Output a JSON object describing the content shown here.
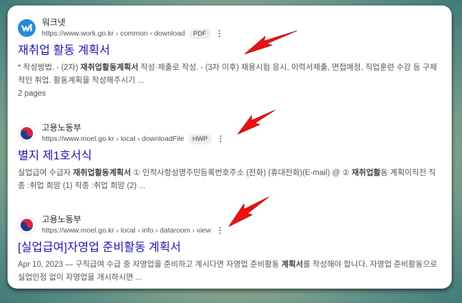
{
  "results": [
    {
      "site_name": "워크넷",
      "url": "https://www.work.go.kr › common › download",
      "badge": "PDF",
      "title": "재취업 활동 계획서",
      "snippet_parts": [
        "* 작성방법. - (2차) ",
        "재취업활동계획서",
        " 작성·제출로 작성. - (3차 이후) 채용시험 응시, 이력서제출, 면접예정, 직업훈련 수강 등 구체적인 취업. 활동계획을 작성해주시기 ..."
      ],
      "extra": "2 pages"
    },
    {
      "site_name": "고용노동부",
      "url": "https://www.moel.go.kr › local › downloadFile",
      "badge": "HWP",
      "title": "별지 제1호서식",
      "snippet_parts": [
        "실업급여 수급자 ",
        "재취업활동계획서",
        " ① 인적사항성명주민등록번호주소 (전화) (휴대전화)(E-mail) @ ② ",
        "재취업활",
        "동 계획이직전 직종 :취업 희망 (1) 직종 :취업 희망 (2) ..."
      ]
    },
    {
      "site_name": "고용노동부",
      "url": "https://www.moel.go.kr › local › info › dataroom › view",
      "title": "[실업급여]자영업 준비활동 계획서",
      "snippet_parts": [
        "Apr 10, 2023 — 구직급여 수급 중 자영업을 준비하고 계시다면 자영업 준비활동 ",
        "계획서",
        "를 작성해야 합니다. 자영업 준비활동으로 실업인정 없이 자영업을 개시하시면 ..."
      ]
    }
  ],
  "colors": {
    "title_link": "#1a0dab",
    "snippet": "#4d5156",
    "arrow": "#ee1111",
    "work_logo": "#2a89d4"
  },
  "icons": {
    "more_menu": "vertical-three-dots",
    "annotation_arrow": "red-arrow-pointing-down-left"
  }
}
